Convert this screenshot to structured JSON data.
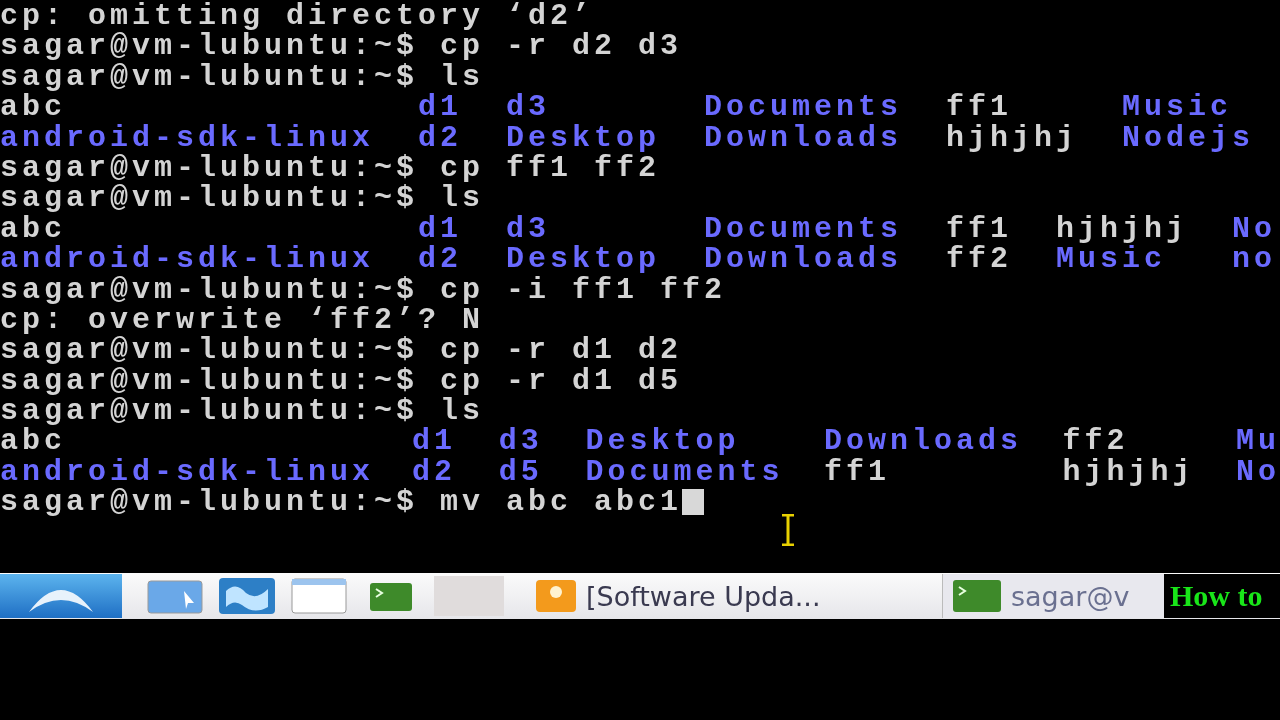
{
  "terminal": {
    "lines": [
      {
        "kind": "text",
        "text": "cp: omitting directory ‘d2’"
      },
      {
        "kind": "prompt",
        "text": "sagar@vm-lubuntu:~$ cp -r d2 d3",
        "cursor": false
      },
      {
        "kind": "prompt",
        "text": "sagar@vm-lubuntu:~$ ls",
        "cursor": false
      },
      {
        "kind": "listing",
        "columns": [
          [
            {
              "text": "abc",
              "kind": "file"
            },
            {
              "text": "android-sdk-linux",
              "kind": "dir"
            }
          ],
          [
            {
              "text": "d1",
              "kind": "dir"
            },
            {
              "text": "d2",
              "kind": "dir"
            }
          ],
          [
            {
              "text": "d3",
              "kind": "dir"
            },
            {
              "text": "Desktop",
              "kind": "dir"
            }
          ],
          [
            {
              "text": "Documents",
              "kind": "dir"
            },
            {
              "text": "Downloads",
              "kind": "dir"
            }
          ],
          [
            {
              "text": "ff1",
              "kind": "file"
            },
            {
              "text": "hjhjhj",
              "kind": "file"
            }
          ],
          [
            {
              "text": "Music",
              "kind": "dir"
            },
            {
              "text": "Nodejs",
              "kind": "dir"
            }
          ]
        ]
      },
      {
        "kind": "prompt",
        "text": "sagar@vm-lubuntu:~$ cp ff1 ff2",
        "cursor": false
      },
      {
        "kind": "prompt",
        "text": "sagar@vm-lubuntu:~$ ls",
        "cursor": false
      },
      {
        "kind": "listing",
        "columns": [
          [
            {
              "text": "abc",
              "kind": "file"
            },
            {
              "text": "android-sdk-linux",
              "kind": "dir"
            }
          ],
          [
            {
              "text": "d1",
              "kind": "dir"
            },
            {
              "text": "d2",
              "kind": "dir"
            }
          ],
          [
            {
              "text": "d3",
              "kind": "dir"
            },
            {
              "text": "Desktop",
              "kind": "dir"
            }
          ],
          [
            {
              "text": "Documents",
              "kind": "dir"
            },
            {
              "text": "Downloads",
              "kind": "dir"
            }
          ],
          [
            {
              "text": "ff1",
              "kind": "file"
            },
            {
              "text": "ff2",
              "kind": "file"
            }
          ],
          [
            {
              "text": "hjhjhj",
              "kind": "file"
            },
            {
              "text": "Music",
              "kind": "dir"
            }
          ],
          [
            {
              "text": "No",
              "kind": "dir"
            },
            {
              "text": "no",
              "kind": "dir"
            }
          ]
        ]
      },
      {
        "kind": "prompt",
        "text": "sagar@vm-lubuntu:~$ cp -i ff1 ff2",
        "cursor": false
      },
      {
        "kind": "text",
        "text": "cp: overwrite ‘ff2’? N"
      },
      {
        "kind": "prompt",
        "text": "sagar@vm-lubuntu:~$ cp -r d1 d2",
        "cursor": false
      },
      {
        "kind": "prompt",
        "text": "sagar@vm-lubuntu:~$ cp -r d1 d5",
        "cursor": false
      },
      {
        "kind": "prompt",
        "text": "sagar@vm-lubuntu:~$ ls",
        "cursor": false
      },
      {
        "kind": "listing",
        "columns": [
          [
            {
              "text": "abc",
              "kind": "file"
            },
            {
              "text": "android-sdk-linux",
              "kind": "dir"
            }
          ],
          [
            {
              "text": "d1",
              "kind": "dir"
            },
            {
              "text": "d2",
              "kind": "dir"
            }
          ],
          [
            {
              "text": "d3",
              "kind": "dir"
            },
            {
              "text": "d5",
              "kind": "dir"
            }
          ],
          [
            {
              "text": "Desktop",
              "kind": "dir"
            },
            {
              "text": "Documents",
              "kind": "dir"
            }
          ],
          [
            {
              "text": "Downloads",
              "kind": "dir"
            },
            {
              "text": "ff1",
              "kind": "file"
            }
          ],
          [
            {
              "text": "ff2",
              "kind": "file"
            },
            {
              "text": "hjhjhj",
              "kind": "file"
            }
          ],
          [
            {
              "text": "Mu",
              "kind": "dir"
            },
            {
              "text": "No",
              "kind": "dir"
            }
          ]
        ]
      },
      {
        "kind": "prompt",
        "text": "sagar@vm-lubuntu:~$ mv abc abc1",
        "cursor": true
      }
    ]
  },
  "taskbar": {
    "tasks": [
      {
        "kind": "blank"
      },
      {
        "kind": "app",
        "label": "[Software Upda..."
      },
      {
        "kind": "terminal",
        "label": "sagar@v"
      }
    ]
  },
  "overlay": {
    "text": "How to"
  }
}
